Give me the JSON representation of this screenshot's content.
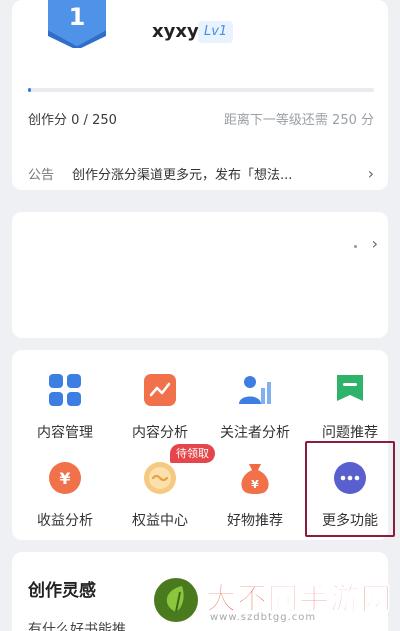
{
  "profile": {
    "level_number": "1",
    "username": "xyxy",
    "level_tag": "Lv1",
    "score_label": "创作分",
    "score_value": "0 / 250",
    "progress_fraction": 0,
    "next_level_text": "距离下一等级还需 250 分"
  },
  "notice": {
    "tag": "公告",
    "text": "创作分涨分渠道更多元，发布「想法..."
  },
  "features": [
    {
      "label": "内容管理",
      "icon": "grid-icon"
    },
    {
      "label": "内容分析",
      "icon": "trend-icon"
    },
    {
      "label": "关注者分析",
      "icon": "follower-chart-icon"
    },
    {
      "label": "问题推荐",
      "icon": "flag-icon"
    },
    {
      "label": "收益分析",
      "icon": "yuan-coin-icon"
    },
    {
      "label": "权益中心",
      "icon": "benefit-icon"
    },
    {
      "label": "好物推荐",
      "icon": "money-bag-icon"
    },
    {
      "label": "更多功能",
      "icon": "more-icon"
    }
  ],
  "pending_badge": "待领取",
  "inspiration": {
    "title": "创作灵感",
    "subtitle": "有什么好书能推"
  },
  "watermark": {
    "text": "大不同手游网",
    "url": "www.szdbtgg.com"
  },
  "colors": {
    "accent": "#3b7de0",
    "badge_red": "#e5464b",
    "highlight": "#8a1d3c"
  }
}
